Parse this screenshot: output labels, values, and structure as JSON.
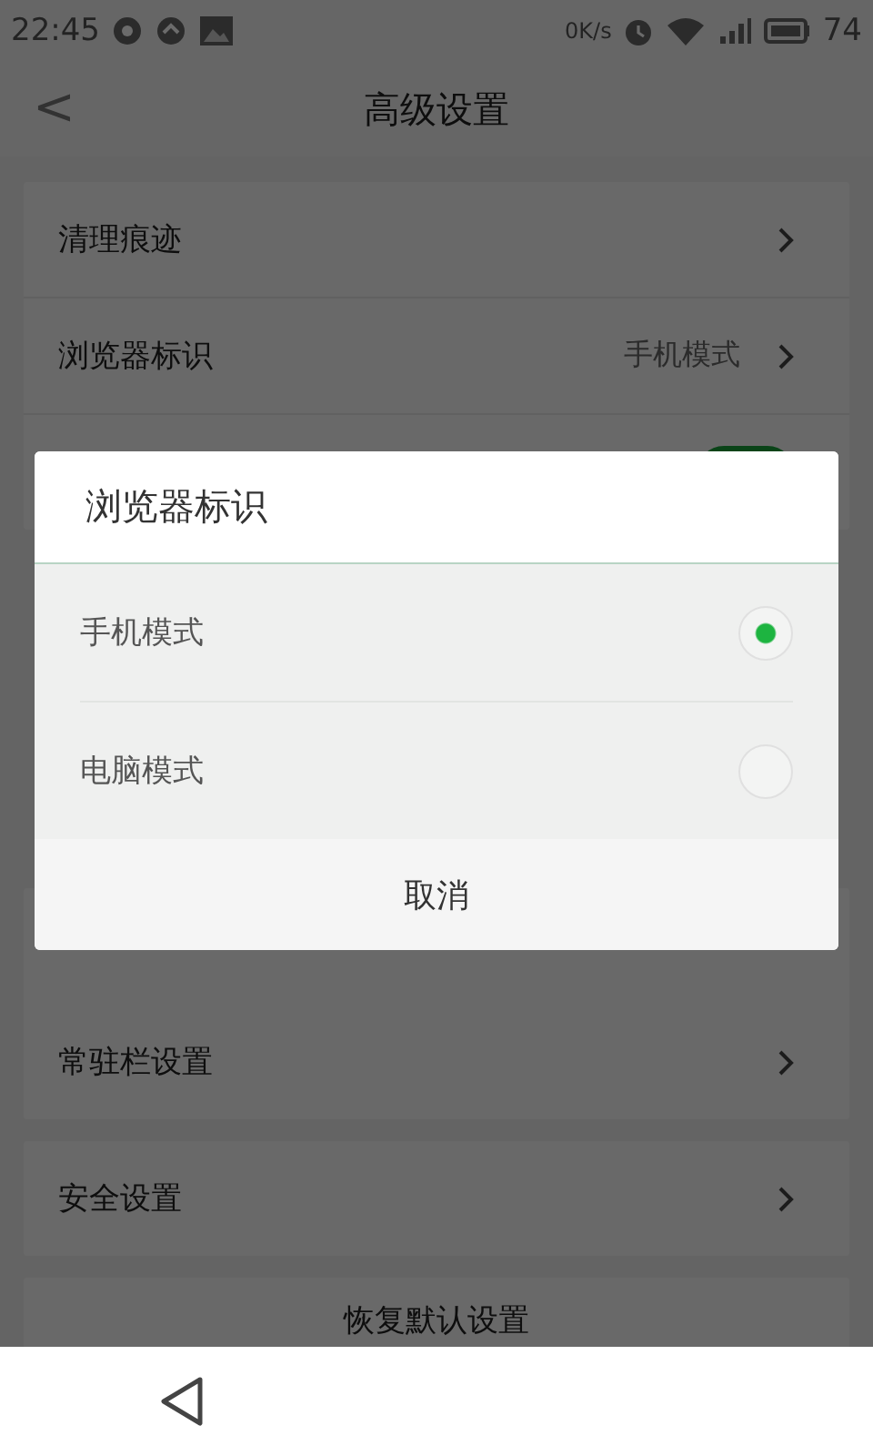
{
  "status_bar": {
    "time": "22:45",
    "speed": "0K/s",
    "battery": "74"
  },
  "header": {
    "back": "<",
    "title": "高级设置"
  },
  "groups": [
    {
      "rows": [
        {
          "kind": "link",
          "label": "清理痕迹"
        },
        {
          "kind": "link",
          "label": "浏览器标识",
          "value": "手机模式"
        },
        {
          "kind": "switch",
          "on": true
        }
      ]
    },
    {
      "rows": [
        {
          "kind": "link",
          "label": "常驻栏设置"
        }
      ]
    },
    {
      "rows": [
        {
          "kind": "link",
          "label": "安全设置"
        }
      ]
    },
    {
      "rows": [
        {
          "kind": "button",
          "label": "恢复默认设置"
        }
      ]
    }
  ],
  "dialog": {
    "title": "浏览器标识",
    "options": [
      {
        "label": "手机模式",
        "selected": true
      },
      {
        "label": "电脑模式",
        "selected": false
      }
    ],
    "cancel": "取消"
  }
}
